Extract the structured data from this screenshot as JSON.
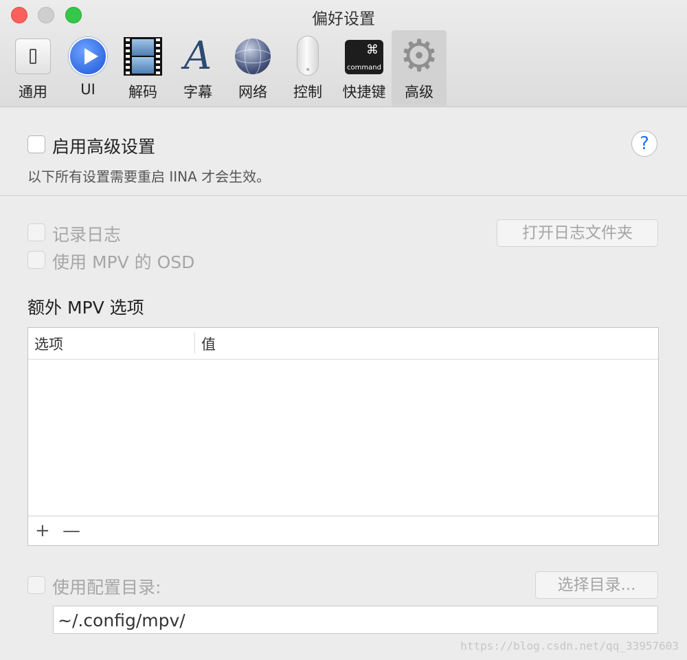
{
  "window": {
    "title": "偏好设置"
  },
  "tabs": [
    {
      "label": "通用",
      "icon": "general-icon"
    },
    {
      "label": "UI",
      "icon": "play-icon"
    },
    {
      "label": "解码",
      "icon": "film-icon"
    },
    {
      "label": "字幕",
      "icon": "subtitle-letter-icon",
      "glyph": "A"
    },
    {
      "label": "网络",
      "icon": "globe-icon"
    },
    {
      "label": "控制",
      "icon": "mouse-icon"
    },
    {
      "label": "快捷键",
      "icon": "command-key-icon",
      "key_symbol": "⌘",
      "key_word": "command"
    },
    {
      "label": "高级",
      "icon": "gear-icon",
      "glyph": "⚙",
      "active": true
    }
  ],
  "advanced": {
    "enable_label": "启用高级设置",
    "enable_checked": false,
    "help_glyph": "?",
    "restart_note": "以下所有设置需要重启 IINA 才会生效。",
    "log_label": "记录日志",
    "open_log_button": "打开日志文件夹",
    "mpv_osd_label": "使用 MPV 的 OSD",
    "extra_options_title": "额外 MPV 选项",
    "table": {
      "columns": [
        "选项",
        "值"
      ],
      "rows": []
    },
    "add_glyph": "+",
    "remove_glyph": "—",
    "config_dir_label": "使用配置目录:",
    "choose_dir_button": "选择目录...",
    "config_dir_value": "~/.config/mpv/"
  },
  "watermark": "https://blog.csdn.net/qq_33957603",
  "colors": {
    "close": "#fc605c",
    "minimize": "#cfcfcf",
    "zoom": "#34c84a",
    "help_accent": "#1b74e8"
  }
}
